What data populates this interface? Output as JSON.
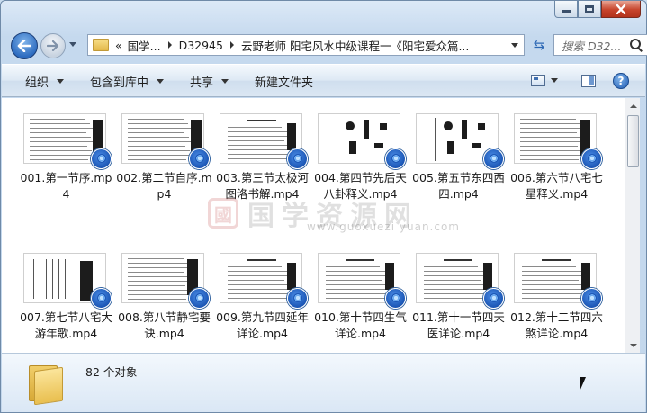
{
  "window": {
    "caption": {
      "minimize": "minimize",
      "maximize": "maximize",
      "close": "close"
    }
  },
  "address": {
    "prefix": "«",
    "crumbs": [
      "国学...",
      "D32945",
      "云野老师 阳宅风水中级课程一《阳宅爱众篇..."
    ],
    "search_placeholder": "搜索 D32..."
  },
  "toolbar": {
    "organize": "组织",
    "include_in_library": "包含到库中",
    "share": "共享",
    "new_folder": "新建文件夹"
  },
  "files": [
    {
      "name": "001.第一节序.mp4"
    },
    {
      "name": "002.第二节自序.mp4"
    },
    {
      "name": "003.第三节太极河图洛书解.mp4"
    },
    {
      "name": "004.第四节先后天八卦释义.mp4"
    },
    {
      "name": "005.第五节东四西四.mp4"
    },
    {
      "name": "006.第六节八宅七星释义.mp4"
    },
    {
      "name": "007.第七节八宅大游年歌.mp4"
    },
    {
      "name": "008.第八节静宅要诀.mp4"
    },
    {
      "name": "009.第九节四延年详论.mp4"
    },
    {
      "name": "010.第十节四生气详论.mp4"
    },
    {
      "name": "011.第十一节四天医详论.mp4"
    },
    {
      "name": "012.第十二节四六煞详论.mp4"
    }
  ],
  "watermark": {
    "seal": "國",
    "text": "国学资源网",
    "url": "www.guoxuezi yuan.com"
  },
  "details": {
    "count_text": "82 个对象"
  }
}
